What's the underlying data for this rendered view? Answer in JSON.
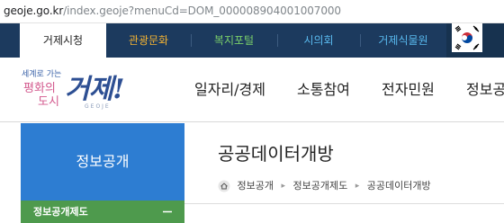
{
  "browser": {
    "url_host": "geoje.go.kr",
    "url_path": "/index.geoje?menuCd=DOM_000008904001007000"
  },
  "top_tabs": [
    {
      "label": "거제시청"
    },
    {
      "label": "관광문화"
    },
    {
      "label": "복지포털"
    },
    {
      "label": "시의회"
    },
    {
      "label": "거제식물원"
    }
  ],
  "colors": {
    "nav_bg": "#1c3a5e",
    "tab_culture": "#f2b233",
    "tab_welfare": "#7bd06a",
    "tab_council": "#59b9ee",
    "sidebar_head": "#2d7dd2",
    "sidebar_item": "#4e9a4d"
  },
  "logo": {
    "slogan": "세계로 가는",
    "line2": "평화의",
    "line3": "도시",
    "name": "거제!",
    "name_en": "GEOJE"
  },
  "main_menu": [
    "일자리/경제",
    "소통참여",
    "전자민원",
    "정보공"
  ],
  "sidebar": {
    "title": "정보공개",
    "items": [
      {
        "label": "정보공개제도",
        "icon": "minus-icon"
      }
    ]
  },
  "content": {
    "title": "공공데이터개방",
    "breadcrumb": [
      "정보공개",
      "정보공개제도",
      "공공데이터개방"
    ],
    "home_icon": "home-icon"
  }
}
